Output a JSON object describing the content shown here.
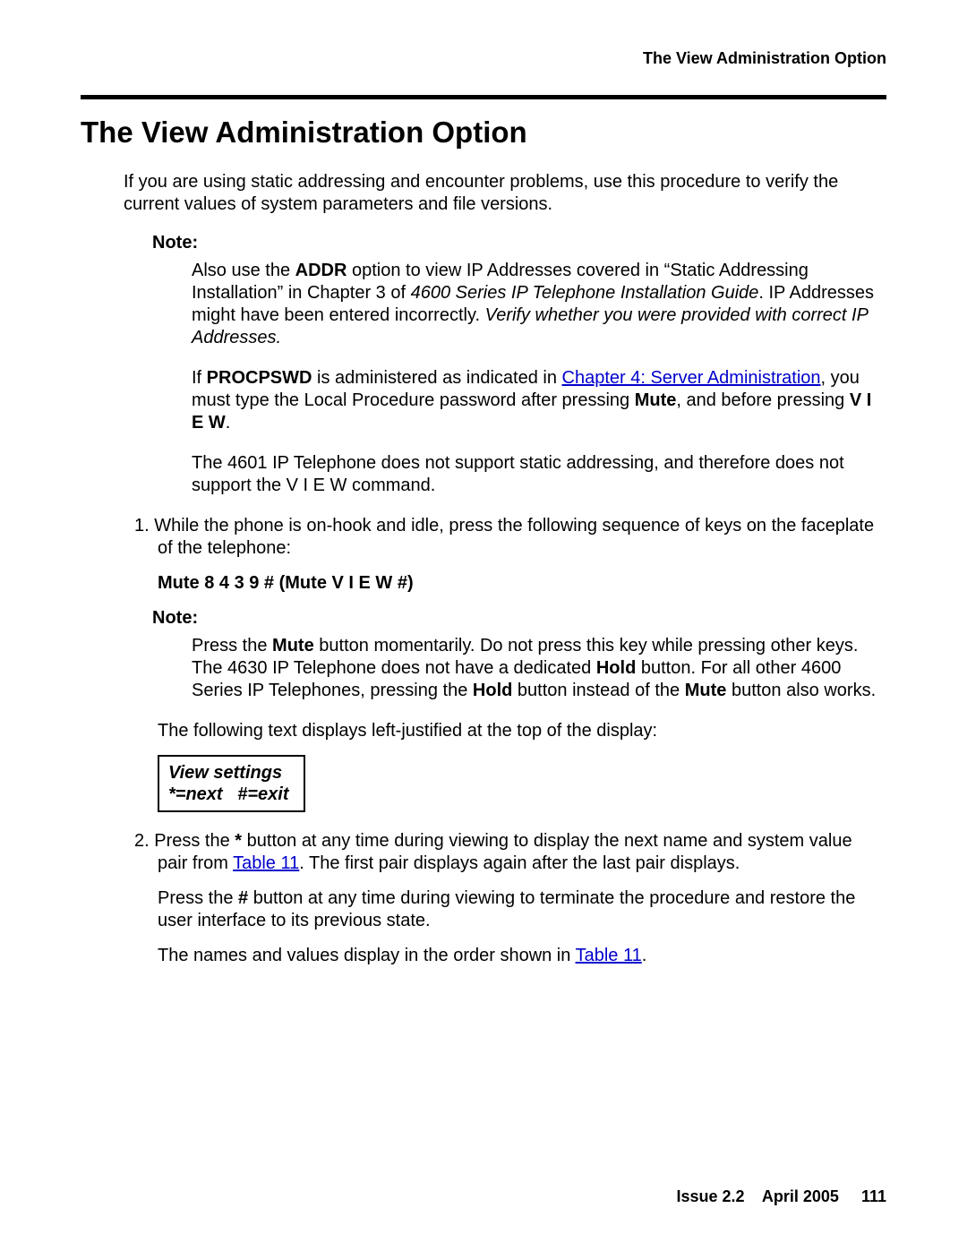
{
  "running_head": "The View Administration Option",
  "title": "The View Administration Option",
  "intro": "If you are using static addressing and encounter problems, use this procedure to verify the current values of system parameters and file versions.",
  "note1": {
    "label": "Note:",
    "p1_a": "Also use the ",
    "p1_b_bold": "ADDR",
    "p1_c": " option to view IP Addresses covered in “Static Addressing Installation” in Chapter 3 of ",
    "p1_d_italic": "4600 Series IP Telephone Installation Guide",
    "p1_e": ". IP Addresses might have been entered incorrectly. ",
    "p1_f_italic": "Verify whether you were provided with correct IP Addresses.",
    "p2_a": "If ",
    "p2_b_bold": "PROCPSWD",
    "p2_c": " is administered as indicated in ",
    "p2_link": "Chapter 4: Server Administration",
    "p2_d": ", you must type the Local Procedure password after pressing ",
    "p2_e_bold": "Mute",
    "p2_f": ", and before pressing ",
    "p2_g_bold": "V I E W",
    "p2_h": ".",
    "p3": "The 4601 IP Telephone does not support static addressing, and therefore does not support the V I E W command."
  },
  "step1": {
    "num": "1. ",
    "text": "While the phone is on-hook and idle, press the following sequence of keys on the faceplate of the telephone:",
    "seq": "Mute 8 4 3 9 # (Mute V I E W #)"
  },
  "note2": {
    "label": "Note:",
    "p1_a": "Press the ",
    "p1_b_bold": "Mute",
    "p1_c": " button momentarily. Do not press this key while pressing other keys. The 4630 IP Telephone does not have a dedicated ",
    "p1_d_bold": "Hold",
    "p1_e": " button. For all other 4600 Series IP Telephones, pressing the ",
    "p1_f_bold": "Hold",
    "p1_g": " button instead of the ",
    "p1_h_bold": "Mute",
    "p1_i": " button also works."
  },
  "after_note2": "The following text displays left-justified at the top of the display:",
  "display_box": "View settings\n*=next   #=exit",
  "step2": {
    "num": "2. ",
    "a": "Press the ",
    "b_bold": "*",
    "c": " button at any time during viewing to display the next name and system value pair from ",
    "link1": "Table 11",
    "d": ". The first pair displays again after the last pair displays.",
    "p2_a": "Press the ",
    "p2_b_bold": "#",
    "p2_c": " button at any time during viewing to terminate the procedure and restore the user interface to its previous state.",
    "p3_a": "The names and values display in the order shown in ",
    "p3_link": "Table 11",
    "p3_b": "."
  },
  "footer": {
    "issue": "Issue 2.2",
    "date": "April 2005",
    "page": "111"
  }
}
